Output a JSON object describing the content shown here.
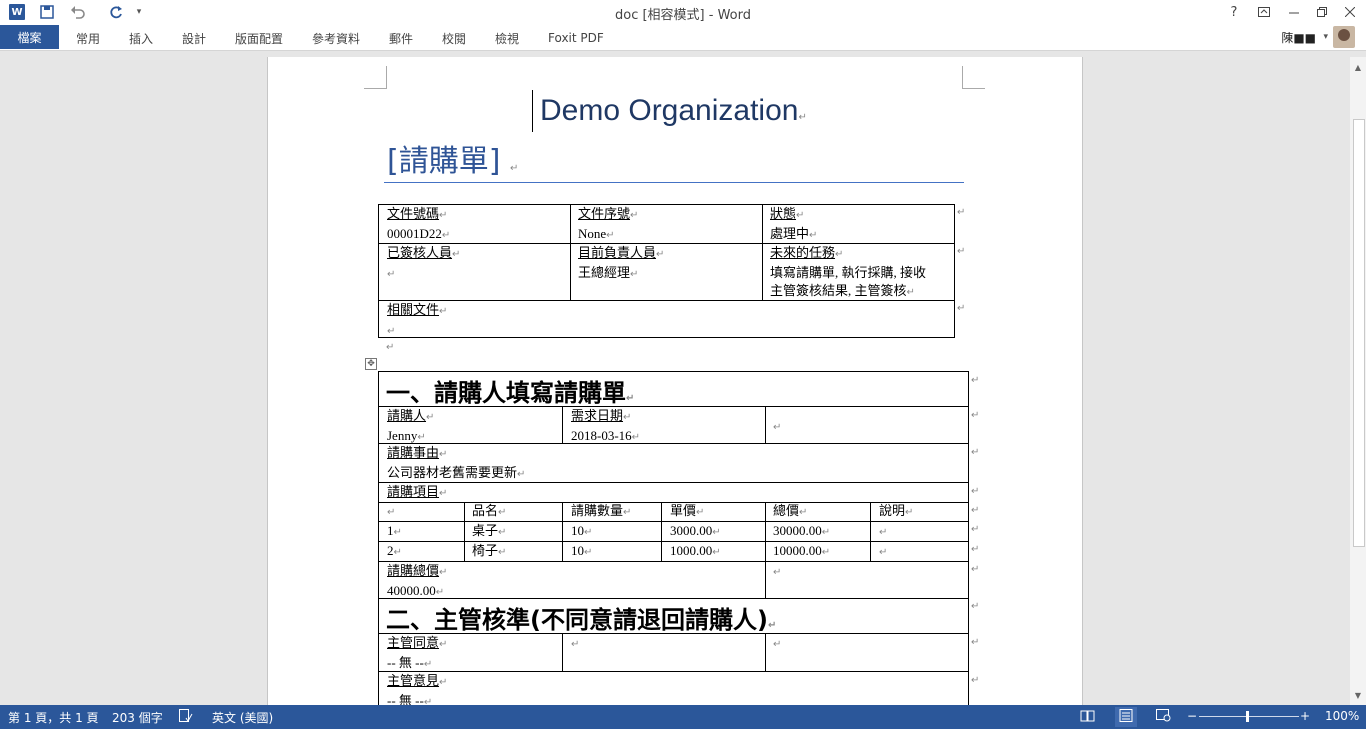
{
  "window": {
    "title": "doc [相容模式] - Word",
    "help": "?",
    "controls": [
      "?",
      "⬒",
      "—",
      "❐",
      "✕"
    ]
  },
  "ribbon": {
    "tabs": [
      "檔案",
      "常用",
      "插入",
      "設計",
      "版面配置",
      "參考資料",
      "郵件",
      "校閱",
      "檢視",
      "Foxit PDF"
    ],
    "user": "陳■■"
  },
  "document": {
    "org": "Demo Organization",
    "form_title": "[請購單]",
    "info": {
      "doc_no_label": "文件號碼",
      "doc_no": "00001D22",
      "doc_seq_label": "文件序號",
      "doc_seq": "None",
      "status_label": "狀態",
      "status": "處理中",
      "signed_label": "已簽核人員",
      "current_label": "目前負責人員",
      "current": "王總經理",
      "future_label": "未來的任務",
      "future_1": "填寫請購單, 執行採購, 接收",
      "future_2": "主管簽核結果, 主管簽核",
      "related_label": "相關文件"
    },
    "section1": "一、請購人填寫請購單",
    "requester_label": "請購人",
    "requester": "Jenny",
    "date_label": "需求日期",
    "date": "2018-03-16",
    "reason_label": "請購事由",
    "reason": "公司器材老舊需要更新",
    "items_label": "請購項目",
    "item_headers": [
      "",
      "品名",
      "請購數量",
      "單價",
      "總價",
      "說明"
    ],
    "items": [
      [
        "1",
        "桌子",
        "10",
        "3000.00",
        "30000.00",
        ""
      ],
      [
        "2",
        "椅子",
        "10",
        "1000.00",
        "10000.00",
        ""
      ]
    ],
    "total_label": "請購總價",
    "total": "40000.00",
    "section2": "二、主管核準(不同意請退回請購人)",
    "approve_label": "主管同意",
    "approve": "-- 無 --",
    "opinion_label": "主管意見",
    "opinion": "-- 無 --"
  },
  "statusbar": {
    "page": "第 1 頁，共 1 頁",
    "words": "203 個字",
    "lang": "英文 (美國)",
    "zoom": "100%"
  },
  "colors": {
    "accent": "#2b579a",
    "heading": "#1f3864"
  }
}
